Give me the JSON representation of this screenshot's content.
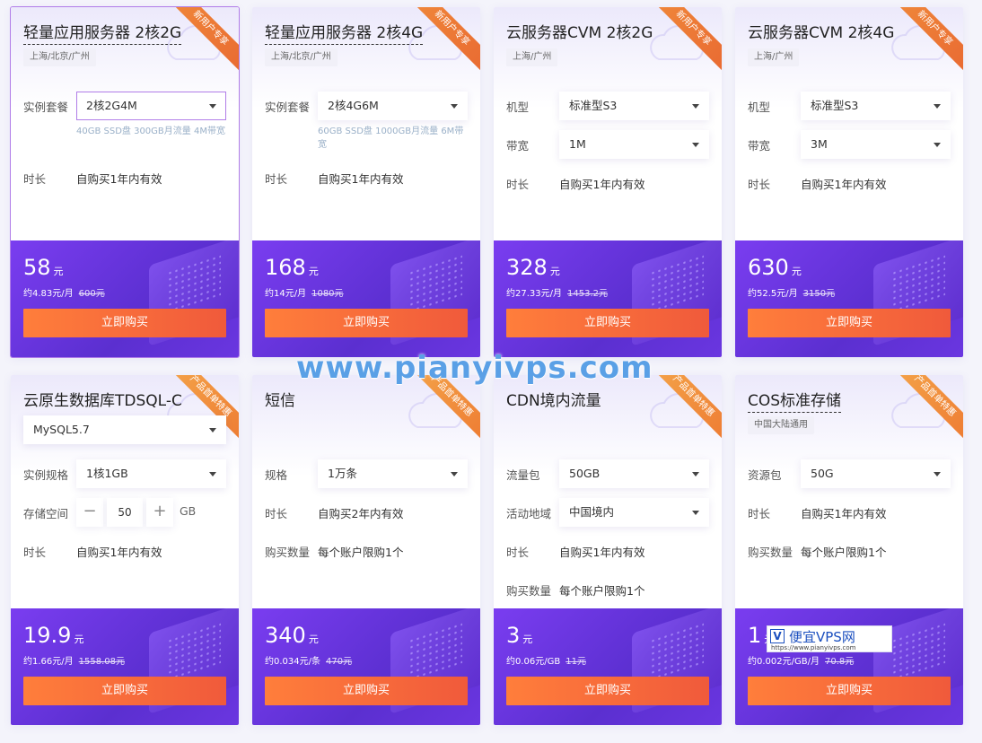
{
  "watermark": "www.pianyivps.com",
  "logo": {
    "mark": "V",
    "title": "便宜VPS网",
    "url": "https://www.pianyivps.com"
  },
  "buy_label": "立即购买",
  "cards": [
    {
      "title": "轻量应用服务器 2核2G",
      "ribbon": "新用户专享",
      "region": "上海/北京/广州",
      "fields": [
        {
          "label": "实例套餐",
          "select": "2核2G4M",
          "hint": "40GB SSD盘 300GB月流量 4M带宽"
        },
        {
          "label": "时长",
          "value": "自购买1年内有效"
        }
      ],
      "price": "58",
      "price_unit": "元",
      "per_month": "约4.83元/月",
      "original": "600元"
    },
    {
      "title": "轻量应用服务器 2核4G",
      "ribbon": "新用户专享",
      "region": "上海/北京/广州",
      "fields": [
        {
          "label": "实例套餐",
          "select": "2核4G6M",
          "hint": "60GB SSD盘 1000GB月流量 6M带宽"
        },
        {
          "label": "时长",
          "value": "自购买1年内有效"
        }
      ],
      "price": "168",
      "price_unit": "元",
      "per_month": "约14元/月",
      "original": "1080元"
    },
    {
      "title": "云服务器CVM 2核2G",
      "ribbon": "新用户专享",
      "region": "上海/广州",
      "fields": [
        {
          "label": "机型",
          "select": "标准型S3"
        },
        {
          "label": "带宽",
          "select": "1M"
        },
        {
          "label": "时长",
          "value": "自购买1年内有效"
        }
      ],
      "price": "328",
      "price_unit": "元",
      "per_month": "约27.33元/月",
      "original": "1453.2元"
    },
    {
      "title": "云服务器CVM 2核4G",
      "ribbon": "新用户专享",
      "region": "上海/广州",
      "fields": [
        {
          "label": "机型",
          "select": "标准型S3"
        },
        {
          "label": "带宽",
          "select": "3M"
        },
        {
          "label": "时长",
          "value": "自购买1年内有效"
        }
      ],
      "price": "630",
      "price_unit": "元",
      "per_month": "约52.5元/月",
      "original": "3150元"
    },
    {
      "title": "云原生数据库TDSQL-C",
      "ribbon": "产品首单特惠",
      "engine": "MySQL5.7",
      "spec_label": "实例规格",
      "spec": "1核1GB",
      "storage_label": "存储空间",
      "storage_value": "50",
      "storage_unit": "GB",
      "minus": "−",
      "plus": "+",
      "time_label": "时长",
      "time_value": "自购买1年内有效",
      "price": "19.9",
      "price_unit": "元",
      "per_month": "约1.66元/月",
      "original": "1558.08元"
    },
    {
      "title": "短信",
      "ribbon": "产品首单特惠",
      "fields": [
        {
          "label": "规格",
          "select": "1万条"
        },
        {
          "label": "时长",
          "value": "自购买2年内有效"
        },
        {
          "label": "购买数量",
          "value": "每个账户限购1个"
        }
      ],
      "price": "340",
      "price_unit": "元",
      "per_month": "约0.034元/条",
      "original": "470元"
    },
    {
      "title": "CDN境内流量",
      "ribbon": "产品首单特惠",
      "fields": [
        {
          "label": "流量包",
          "select": "50GB"
        },
        {
          "label": "活动地域",
          "select": "中国境内"
        },
        {
          "label": "时长",
          "value": "自购买1年内有效"
        },
        {
          "label": "购买数量",
          "value": "每个账户限购1个"
        }
      ],
      "price": "3",
      "price_unit": "元",
      "per_month": "约0.06元/GB",
      "original": "11元"
    },
    {
      "title": "COS标准存储",
      "ribbon": "产品首单特惠",
      "region": "中国大陆通用",
      "fields": [
        {
          "label": "资源包",
          "select": "50G"
        },
        {
          "label": "时长",
          "value": "自购买1年内有效"
        },
        {
          "label": "购买数量",
          "value": "每个账户限购1个"
        }
      ],
      "price": "1",
      "price_unit": "元",
      "per_month": "约0.002元/GB/月",
      "original": "70.8元"
    }
  ]
}
